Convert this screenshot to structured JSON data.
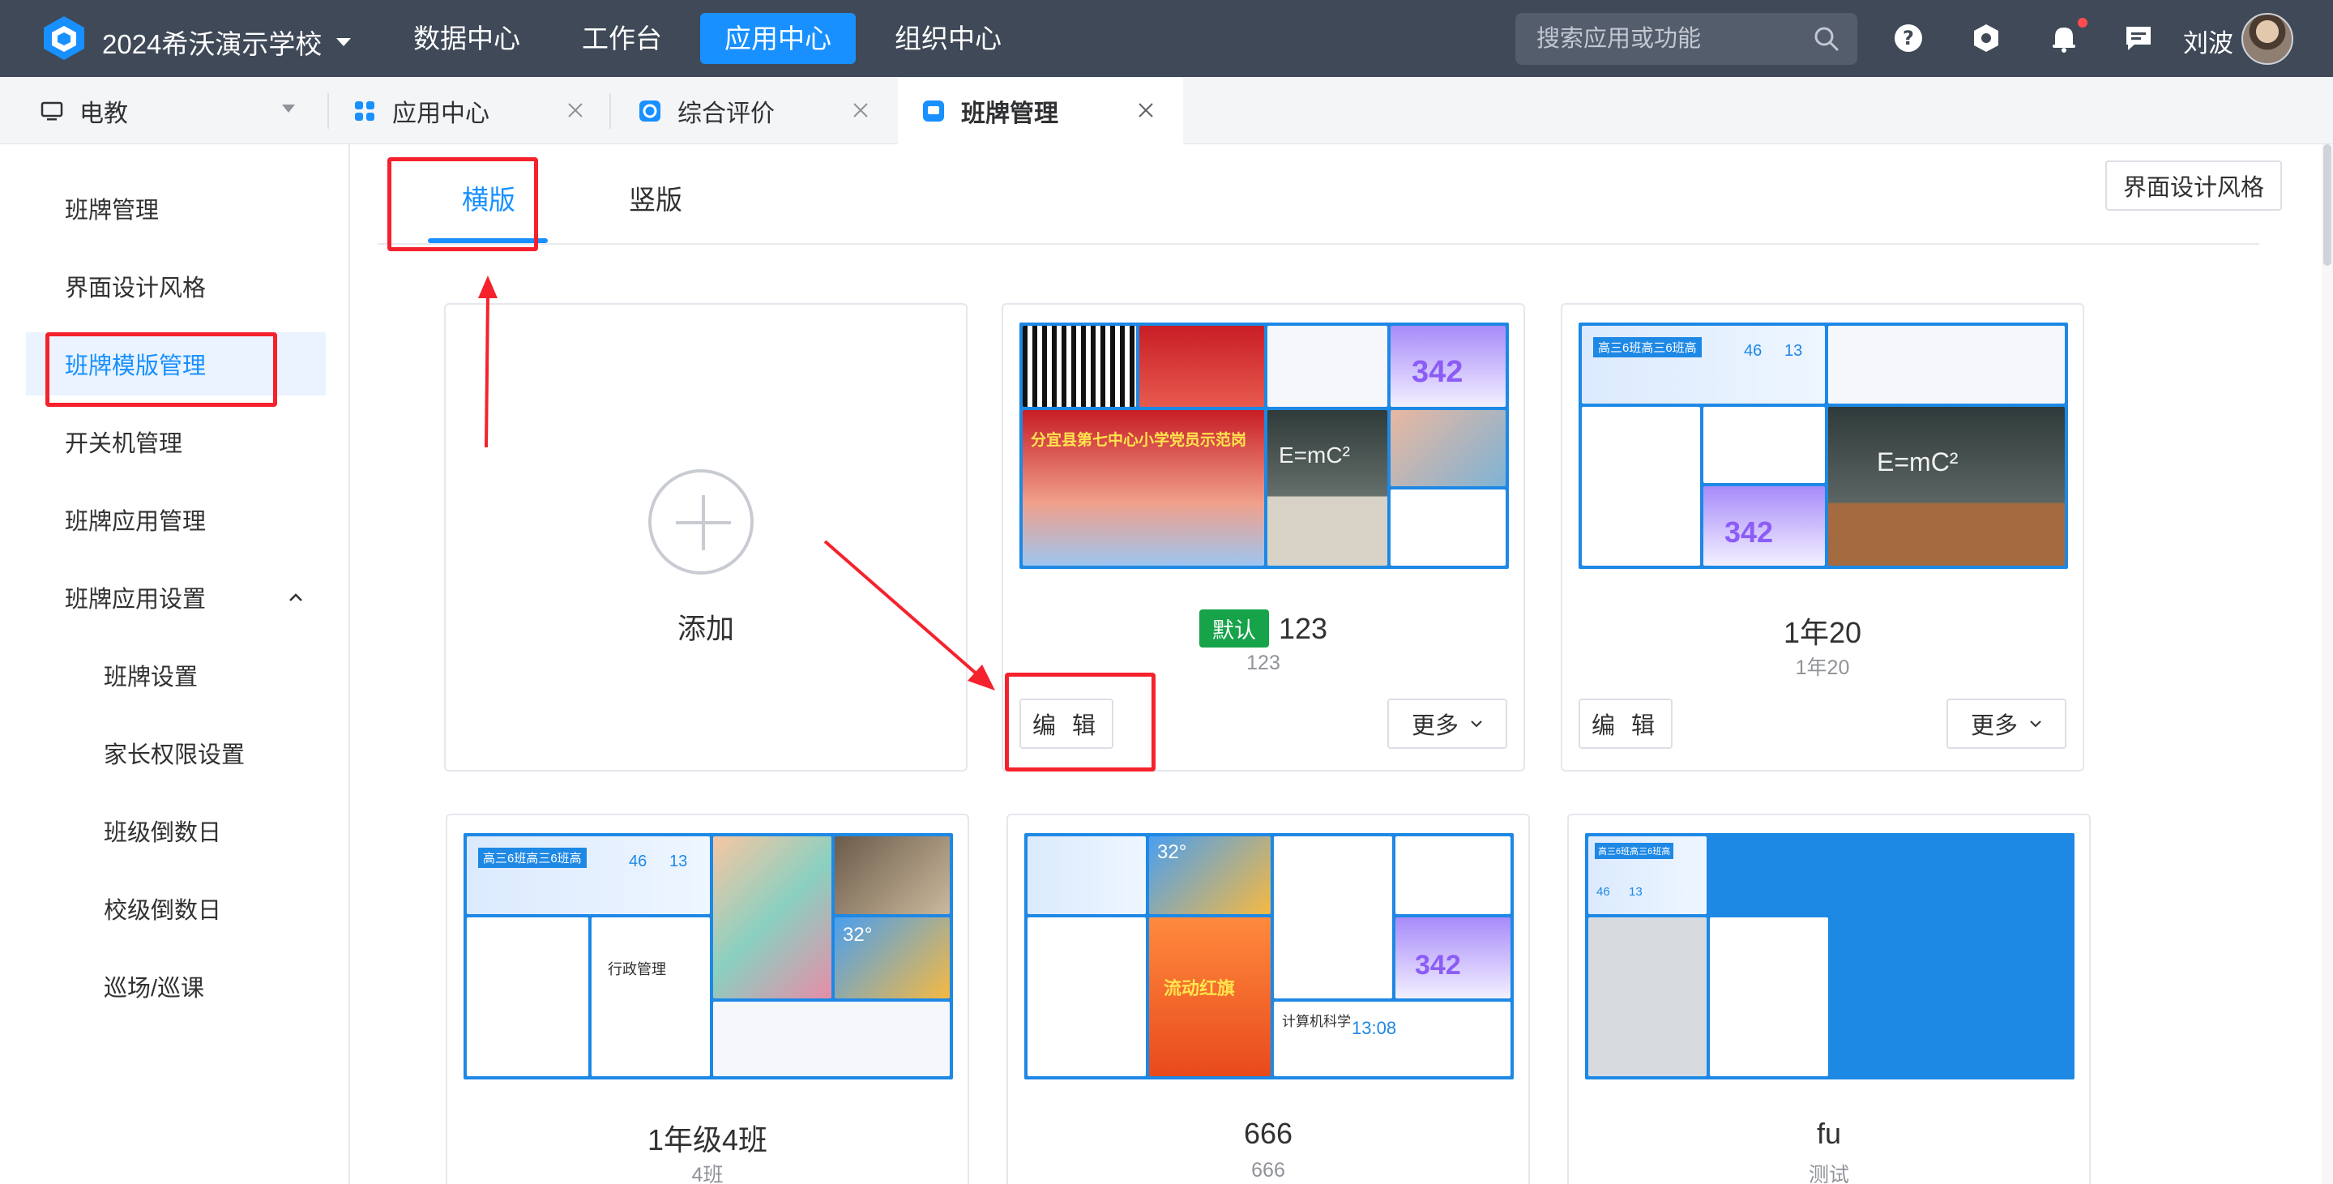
{
  "header": {
    "school_name": "2024希沃演示学校",
    "nav": [
      "数据中心",
      "工作台",
      "应用中心",
      "组织中心"
    ],
    "active_nav": "应用中心",
    "search_placeholder": "搜索应用或功能",
    "user_name": "刘波",
    "icons": [
      "help-icon",
      "settings-hex-icon",
      "bell-icon",
      "message-icon"
    ]
  },
  "tabs": [
    {
      "label": "电教",
      "icon": "monitor-icon"
    },
    {
      "label": "应用中心",
      "icon": "grid-icon"
    },
    {
      "label": "综合评价",
      "icon": "evaluation-icon"
    },
    {
      "label": "班牌管理",
      "icon": "board-icon",
      "active": true
    }
  ],
  "sidebar": {
    "items": [
      {
        "label": "班牌管理"
      },
      {
        "label": "界面设计风格"
      },
      {
        "label": "班牌模版管理",
        "active": true
      },
      {
        "label": "开关机管理"
      },
      {
        "label": "班牌应用管理"
      },
      {
        "label": "班牌应用设置",
        "expanded": true
      },
      {
        "label": "班牌设置"
      },
      {
        "label": "家长权限设置"
      },
      {
        "label": "班级倒数日"
      },
      {
        "label": "校级倒数日"
      },
      {
        "label": "巡场/巡课"
      }
    ]
  },
  "main": {
    "orientation_tabs": [
      {
        "label": "横版",
        "active": true
      },
      {
        "label": "竖版"
      }
    ],
    "design_button": "界面设计风格",
    "add_label": "添加",
    "templates": [
      {
        "title": "123",
        "subtitle": "123",
        "default_badge": "默认",
        "edit": "编 辑",
        "more": "更多",
        "thumb_text": {
          "banner": "分宜县第七中心小学党员示范岗",
          "count": "342",
          "equation": "E=mC²"
        }
      },
      {
        "title": "1年20",
        "subtitle": "1年20",
        "edit": "编 辑",
        "more": "更多",
        "thumb_text": {
          "banner": "高三6班高三6班高",
          "count": "342",
          "equation": "E=mC²",
          "n1": "46",
          "n2": "13"
        }
      },
      {
        "title": "1年级4班",
        "subtitle": "4班",
        "thumb_text": {
          "banner": "高三6班高三6班高",
          "n1": "46",
          "n2": "13",
          "panel": "行政管理",
          "temp": "32°"
        }
      },
      {
        "title": "666",
        "subtitle": "666",
        "thumb_text": {
          "temp": "32°",
          "count": "342",
          "red": "流动红旗",
          "course": "计算机科学",
          "time": "13:08"
        }
      },
      {
        "title": "fu",
        "subtitle": "测试",
        "thumb_text": {
          "banner": "高三6班高三6班高",
          "n1": "46",
          "n2": "13"
        }
      }
    ]
  },
  "colors": {
    "topbar": "#3f4957",
    "accent": "#1890ff",
    "highlight": "#f5222d",
    "default_badge": "#16a34a"
  }
}
